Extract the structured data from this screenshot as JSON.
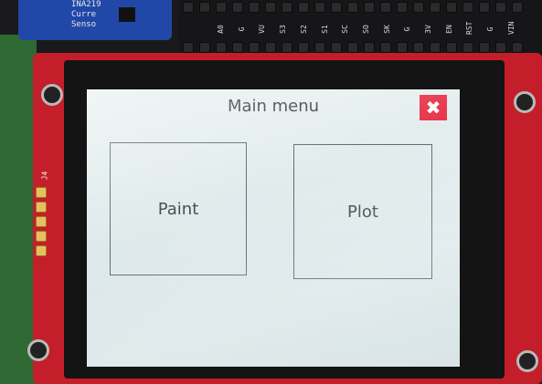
{
  "screen": {
    "title": "Main menu",
    "close_button": {
      "icon": "close-icon",
      "glyph": "✖",
      "color": "#e8344a"
    },
    "menu_items": [
      {
        "label": "Paint"
      },
      {
        "label": "Plot"
      }
    ]
  },
  "hardware": {
    "sensor_board_text": [
      "INA219",
      "Curre",
      "Senso"
    ],
    "silkscreen_j4": "J4",
    "pin_labels": [
      "A0",
      "G",
      "VU",
      "S3",
      "S2",
      "S1",
      "SC",
      "SO",
      "SK",
      "G",
      "3V",
      "EN",
      "RST",
      "G",
      "VIN"
    ]
  }
}
